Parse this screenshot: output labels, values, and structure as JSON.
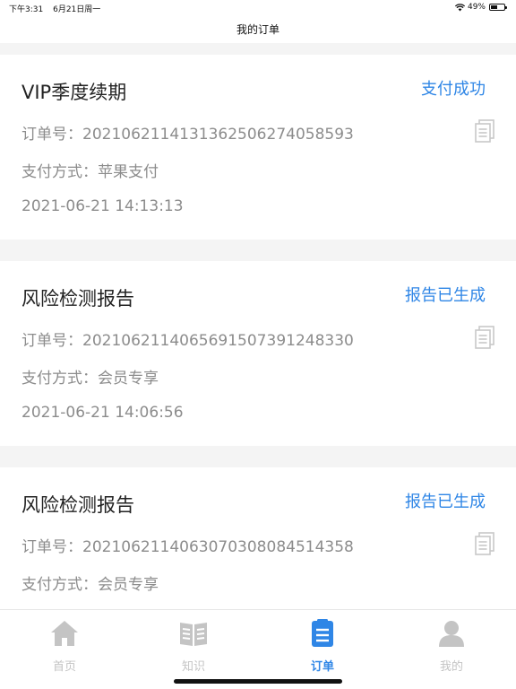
{
  "status_bar": {
    "time": "下午3:31",
    "date": "6月21日周一",
    "battery_text": "49%",
    "battery_level": 0.49
  },
  "nav": {
    "title": "我的订单"
  },
  "orders": [
    {
      "title": "VIP季度续期",
      "status": "支付成功",
      "order_no": "订单号：20210621141313625062740585​93",
      "payment": "支付方式：苹果支付",
      "time": "2021-06-21 14:13:13"
    },
    {
      "title": "风险检测报告",
      "status": "报告已生成",
      "order_no": "订单号：20210621140656915073912483​30",
      "payment": "支付方式：会员专享",
      "time": "2021-06-21 14:06:56"
    },
    {
      "title": "风险检测报告",
      "status": "报告已生成",
      "order_no": "订单号：20210621140630703080845143​58",
      "payment": "支付方式：会员专享",
      "time": ""
    }
  ],
  "tabs": [
    {
      "label": "首页",
      "icon": "home-icon",
      "active": false
    },
    {
      "label": "知识",
      "icon": "book-icon",
      "active": false
    },
    {
      "label": "订单",
      "icon": "order-list-icon",
      "active": true
    },
    {
      "label": "我的",
      "icon": "user-icon",
      "active": false
    }
  ],
  "colors": {
    "accent": "#2f86e6",
    "inactive_tab": "#c4c4c4",
    "secondary_text": "#8c8c8c",
    "background": "#f4f4f4"
  }
}
